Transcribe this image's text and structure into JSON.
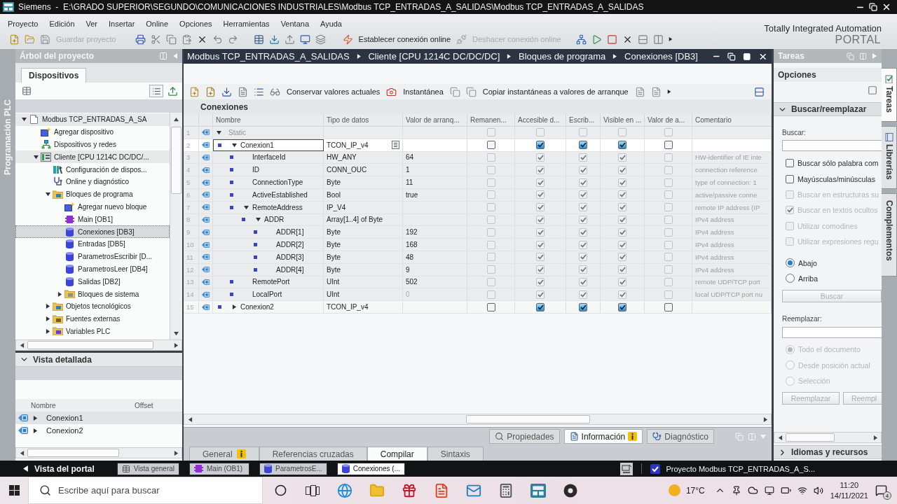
{
  "title_bar": {
    "title": "Siemens  -  E:\\GRADO SUPERIOR\\SEGUNDO\\COMUNICACIONES INDUSTRIALES\\Modbus TCP_ENTRADAS_A_SALIDAS\\Modbus TCP_ENTRADAS_A_SALIDAS"
  },
  "menu": [
    "Proyecto",
    "Edición",
    "Ver",
    "Insertar",
    "Online",
    "Opciones",
    "Herramientas",
    "Ventana",
    "Ayuda"
  ],
  "toolbar": [
    {
      "label": "Guardar proyecto",
      "disabled": true
    },
    {
      "label": "Establecer conexión online",
      "disabled": false
    },
    {
      "label": "Deshacer conexión online",
      "disabled": true
    }
  ],
  "brand": {
    "line_1": "Totally Integrated Automation",
    "line_2": "PORTAL"
  },
  "side_strip": {
    "label": "Programación PLC"
  },
  "project_tree": {
    "title": "Árbol del proyecto",
    "tab": "Dispositivos",
    "items": [
      {
        "label": "Modbus TCP_ENTRADAS_A_SA",
        "kind": "project",
        "expanded": true,
        "selected": false,
        "children": [
          {
            "label": "Agregar dispositivo",
            "kind": "add-device",
            "selected": false
          },
          {
            "label": "Dispositivos y redes",
            "kind": "network",
            "selected": false
          },
          {
            "label": "Cliente [CPU 1214C DC/DC/...",
            "kind": "device",
            "expanded": true,
            "selected": false,
            "children": [
              {
                "label": "Configuración de dispos...",
                "kind": "device-config",
                "selected": false
              },
              {
                "label": "Online y diagnóstico",
                "kind": "diagnostics",
                "selected": false
              },
              {
                "label": "Bloques de programa",
                "kind": "blocks-folder",
                "expanded": true,
                "selected": false,
                "children": [
                  {
                    "label": "Agregar nuevo bloque",
                    "kind": "add-block",
                    "selected": false
                  },
                  {
                    "label": "Main [OB1]",
                    "kind": "ob",
                    "selected": false
                  },
                  {
                    "label": "Conexiones [DB3]",
                    "kind": "db",
                    "selected": true
                  },
                  {
                    "label": "Entradas [DB5]",
                    "kind": "db",
                    "selected": false
                  },
                  {
                    "label": "ParametrosEscribir [D...",
                    "kind": "db",
                    "selected": false
                  },
                  {
                    "label": "ParametrosLeer [DB4]",
                    "kind": "db",
                    "selected": false
                  },
                  {
                    "label": "Salidas [DB2]",
                    "kind": "db",
                    "selected": false
                  },
                  {
                    "label": "Bloques de sistema",
                    "kind": "system-folder",
                    "expanded": false,
                    "selected": false
                  }
                ]
              },
              {
                "label": "Objetos tecnológicos",
                "kind": "tech-folder",
                "expanded": false,
                "selected": false
              },
              {
                "label": "Fuentes externas",
                "kind": "sources-folder",
                "expanded": false,
                "selected": false
              },
              {
                "label": "Variables PLC",
                "kind": "tags-folder",
                "expanded": false,
                "selected": false
              }
            ]
          }
        ]
      }
    ]
  },
  "detail_view": {
    "title": "Vista detallada",
    "expanded": true,
    "columns": [
      "Nombre",
      "Offset"
    ],
    "rows": [
      {
        "name": "Conexion1",
        "expanded": false,
        "selected": true
      },
      {
        "name": "Conexion2",
        "expanded": false,
        "selected": false
      }
    ]
  },
  "editor": {
    "breadcrumb": [
      "Modbus TCP_ENTRADAS_A_SALIDAS",
      "Cliente [CPU 1214C DC/DC/DC]",
      "Bloques de programa",
      "Conexiones [DB3]"
    ],
    "toolbar": [
      "Conservar valores actuales",
      "Instantánea",
      "Copiar instantáneas a valores de arranque"
    ],
    "block_title": "Conexiones",
    "columns": [
      "Nombre",
      "Tipo de datos",
      "Valor de arranq...",
      "Remanen...",
      "Accesible d...",
      "Escrib...",
      "Visible en ...",
      "Valor de a...",
      "Comentario"
    ],
    "rows": [
      {
        "number": "1",
        "kind": "section",
        "name": "Static",
        "expanded": true,
        "selected": false,
        "disabled": true,
        "checks": [
          {
            "checked": false
          },
          {
            "checked": false
          },
          {
            "checked": false
          },
          {
            "checked": false
          },
          {
            "checked": false
          }
        ],
        "children": [
          {
            "number": "2",
            "kind": "member",
            "name": "Conexion1",
            "type": "TCON_IP_v4",
            "expanded": true,
            "selected": true,
            "disabled": false,
            "checks": [
              {
                "checked": false
              },
              {
                "checked": true
              },
              {
                "checked": true
              },
              {
                "checked": true
              },
              {
                "checked": false
              }
            ],
            "children": [
              {
                "number": "3",
                "kind": "member",
                "name": "InterfaceId",
                "type": "HW_ANY",
                "start_value": "64",
                "start_value_dimmed": false,
                "comment": "HW-identifier of IE inte",
                "selected": false,
                "disabled": true,
                "checks": [
                  {
                    "checked": false
                  },
                  {
                    "checked": true
                  },
                  {
                    "checked": true
                  },
                  {
                    "checked": true
                  },
                  {
                    "checked": false
                  }
                ]
              },
              {
                "number": "4",
                "kind": "member",
                "name": "ID",
                "type": "CONN_OUC",
                "start_value": "1",
                "start_value_dimmed": false,
                "comment": "connection reference",
                "selected": false,
                "disabled": true,
                "checks": [
                  {
                    "checked": false
                  },
                  {
                    "checked": true
                  },
                  {
                    "checked": true
                  },
                  {
                    "checked": true
                  },
                  {
                    "checked": false
                  }
                ]
              },
              {
                "number": "5",
                "kind": "member",
                "name": "ConnectionType",
                "type": "Byte",
                "start_value": "11",
                "start_value_dimmed": false,
                "comment": "type of connection: 1",
                "selected": false,
                "disabled": true,
                "checks": [
                  {
                    "checked": false
                  },
                  {
                    "checked": true
                  },
                  {
                    "checked": true
                  },
                  {
                    "checked": true
                  },
                  {
                    "checked": false
                  }
                ]
              },
              {
                "number": "6",
                "kind": "member",
                "name": "ActiveEstablished",
                "type": "Bool",
                "start_value": "true",
                "start_value_dimmed": false,
                "comment": "active/passive conne",
                "selected": false,
                "disabled": true,
                "checks": [
                  {
                    "checked": false
                  },
                  {
                    "checked": true
                  },
                  {
                    "checked": true
                  },
                  {
                    "checked": true
                  },
                  {
                    "checked": false
                  }
                ]
              },
              {
                "number": "7",
                "kind": "member",
                "name": "RemoteAddress",
                "type": "IP_V4",
                "expanded": true,
                "comment": "remote IP address (IP",
                "selected": false,
                "disabled": true,
                "checks": [
                  {
                    "checked": false
                  },
                  {
                    "checked": true
                  },
                  {
                    "checked": true
                  },
                  {
                    "checked": true
                  },
                  {
                    "checked": false
                  }
                ],
                "children": [
                  {
                    "number": "8",
                    "kind": "member",
                    "name": "ADDR",
                    "type": "Array[1..4] of Byte",
                    "expanded": true,
                    "comment": "IPv4 address",
                    "selected": false,
                    "disabled": true,
                    "checks": [
                      {
                        "checked": false
                      },
                      {
                        "checked": true
                      },
                      {
                        "checked": true
                      },
                      {
                        "checked": true
                      },
                      {
                        "checked": false
                      }
                    ],
                    "children": [
                      {
                        "number": "9",
                        "kind": "member",
                        "name": "ADDR[1]",
                        "type": "Byte",
                        "start_value": "192",
                        "start_value_dimmed": false,
                        "comment": "IPv4 address",
                        "selected": false,
                        "disabled": true,
                        "checks": [
                          {
                            "checked": false
                          },
                          {
                            "checked": true
                          },
                          {
                            "checked": true
                          },
                          {
                            "checked": true
                          },
                          {
                            "checked": false
                          }
                        ]
                      },
                      {
                        "number": "10",
                        "kind": "member",
                        "name": "ADDR[2]",
                        "type": "Byte",
                        "start_value": "168",
                        "start_value_dimmed": false,
                        "comment": "IPv4 address",
                        "selected": false,
                        "disabled": true,
                        "checks": [
                          {
                            "checked": false
                          },
                          {
                            "checked": true
                          },
                          {
                            "checked": true
                          },
                          {
                            "checked": true
                          },
                          {
                            "checked": false
                          }
                        ]
                      },
                      {
                        "number": "11",
                        "kind": "member",
                        "name": "ADDR[3]",
                        "type": "Byte",
                        "start_value": "48",
                        "start_value_dimmed": false,
                        "comment": "IPv4 address",
                        "selected": false,
                        "disabled": true,
                        "checks": [
                          {
                            "checked": false
                          },
                          {
                            "checked": true
                          },
                          {
                            "checked": true
                          },
                          {
                            "checked": true
                          },
                          {
                            "checked": false
                          }
                        ]
                      },
                      {
                        "number": "12",
                        "kind": "member",
                        "name": "ADDR[4]",
                        "type": "Byte",
                        "start_value": "9",
                        "start_value_dimmed": false,
                        "comment": "IPv4 address",
                        "selected": false,
                        "disabled": true,
                        "checks": [
                          {
                            "checked": false
                          },
                          {
                            "checked": true
                          },
                          {
                            "checked": true
                          },
                          {
                            "checked": true
                          },
                          {
                            "checked": false
                          }
                        ]
                      }
                    ]
                  }
                ]
              },
              {
                "number": "13",
                "kind": "member",
                "name": "RemotePort",
                "type": "UInt",
                "start_value": "502",
                "start_value_dimmed": false,
                "comment": "remote UDP/TCP port",
                "selected": false,
                "disabled": true,
                "checks": [
                  {
                    "checked": false
                  },
                  {
                    "checked": true
                  },
                  {
                    "checked": true
                  },
                  {
                    "checked": true
                  },
                  {
                    "checked": false
                  }
                ]
              },
              {
                "number": "14",
                "kind": "member",
                "name": "LocalPort",
                "type": "UInt",
                "start_value": "0",
                "start_value_dimmed": true,
                "comment": "local UDP/TCP port nu",
                "selected": false,
                "disabled": true,
                "checks": [
                  {
                    "checked": false
                  },
                  {
                    "checked": true
                  },
                  {
                    "checked": true
                  },
                  {
                    "checked": true
                  },
                  {
                    "checked": false
                  }
                ]
              }
            ]
          },
          {
            "number": "15",
            "kind": "member",
            "name": "Conexion2",
            "type": "TCON_IP_v4",
            "expanded": false,
            "selected": false,
            "disabled": false,
            "checks": [
              {
                "checked": false
              },
              {
                "checked": true
              },
              {
                "checked": true
              },
              {
                "checked": true
              },
              {
                "checked": false
              }
            ]
          }
        ]
      }
    ]
  },
  "inspector": {
    "tabs": [
      {
        "label": "Propiedades",
        "selected": false
      },
      {
        "label": "Información",
        "selected": true
      },
      {
        "label": "Diagnóstico",
        "selected": false
      }
    ],
    "subtabs": [
      {
        "label": "General",
        "selected": false
      },
      {
        "label": "Referencias cruzadas",
        "selected": false
      },
      {
        "label": "Compilar",
        "selected": true
      },
      {
        "label": "Sintaxis",
        "selected": false
      }
    ]
  },
  "task_panel": {
    "title": "Tareas",
    "header": "Opciones",
    "find_section": {
      "title": "Buscar/reemplazar",
      "expanded": true
    },
    "search_label": "Buscar:",
    "options": [
      {
        "label": "Buscar sólo palabra com",
        "checked": false,
        "disabled": false
      },
      {
        "label": "Mayúsculas/minúsculas",
        "checked": false,
        "disabled": false
      },
      {
        "label": "Buscar en estructuras su",
        "checked": false,
        "disabled": true
      },
      {
        "label": "Buscar en textos ocultos",
        "checked": true,
        "disabled": true
      },
      {
        "label": "Utilizar comodines",
        "checked": false,
        "disabled": true
      },
      {
        "label": "Utilizar expresiones regu",
        "checked": false,
        "disabled": true
      }
    ],
    "direction": [
      {
        "label": "Abajo",
        "selected": true,
        "disabled": false
      },
      {
        "label": "Arriba",
        "selected": false,
        "disabled": false
      }
    ],
    "search_button": {
      "label": "Buscar",
      "disabled": true
    },
    "replace_label": "Reemplazar:",
    "scope": [
      {
        "label": "Todo el documento",
        "selected": true,
        "disabled": true
      },
      {
        "label": "Desde posición actual",
        "selected": false,
        "disabled": true
      },
      {
        "label": "Selección",
        "selected": false,
        "disabled": true
      }
    ],
    "replace_buttons": [
      {
        "label": "Reemplazar",
        "disabled": true
      },
      {
        "label": "Reempl",
        "disabled": true
      }
    ],
    "languages_section": {
      "title": "Idiomas y recursos",
      "expanded": false
    }
  },
  "side_tabs": [
    {
      "label": "Tareas",
      "selected": true
    },
    {
      "label": "Librerías",
      "selected": false
    },
    {
      "label": "Complementos",
      "selected": false
    }
  ],
  "portal_bar": {
    "portal_label": "Vista del portal",
    "tabs": [
      {
        "label": "Vista general",
        "kind": "overview",
        "selected": false
      },
      {
        "label": "Main (OB1)",
        "kind": "ob",
        "selected": false
      },
      {
        "label": "ParametrosE...",
        "kind": "db",
        "selected": false
      },
      {
        "label": "Conexiones (...",
        "kind": "db",
        "selected": true
      }
    ],
    "status": "Proyecto Modbus TCP_ENTRADAS_A_S..."
  },
  "taskbar": {
    "search_placeholder": "Escribe aquí para buscar",
    "temperature": "17°C",
    "time": "11:20",
    "date": "14/11/2021",
    "notification_count": "4"
  }
}
